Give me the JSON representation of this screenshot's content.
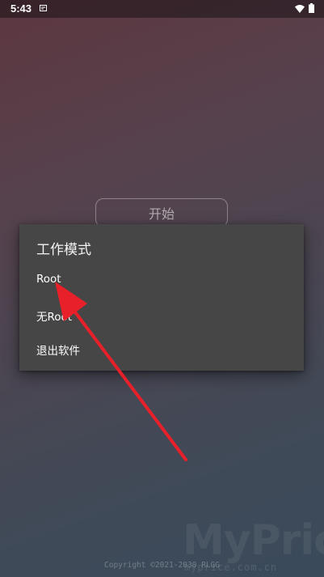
{
  "status_bar": {
    "time": "5:43",
    "icons": [
      "notification-icon",
      "wifi-icon",
      "battery-icon"
    ]
  },
  "main": {
    "start_label": "开始"
  },
  "dialog": {
    "title": "工作模式",
    "options": [
      "Root",
      "无Root",
      "退出软件"
    ]
  },
  "footer": {
    "copyright": "Copyright ©2021-2030 RLGG"
  },
  "watermark": {
    "brand": "MyPrice",
    "site": "myprice.com.cn"
  },
  "colors": {
    "dialog_bg": "#464646",
    "arrow": "#e8202a",
    "bg_top": "#5d3740",
    "bg_bottom": "#3a4a5a"
  }
}
